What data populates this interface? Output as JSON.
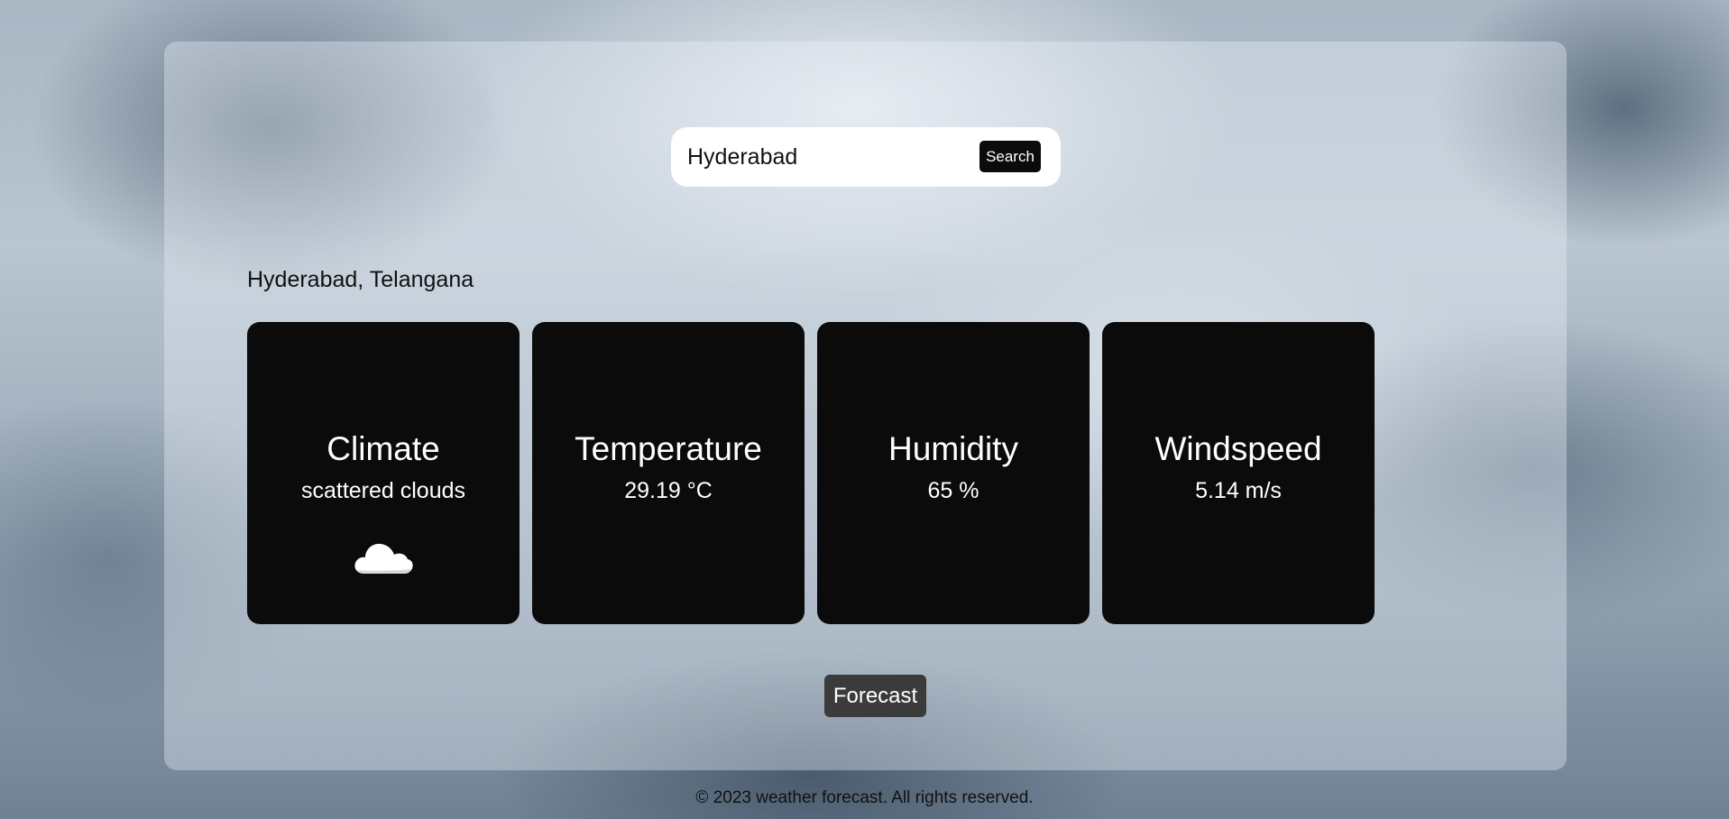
{
  "search": {
    "value": "Hyderabad",
    "button_label": "Search"
  },
  "location": "Hyderabad, Telangana",
  "cards": [
    {
      "title": "Climate",
      "value": "scattered clouds",
      "icon": "cloud-icon"
    },
    {
      "title": "Temperature",
      "value": "29.19 °C"
    },
    {
      "title": "Humidity",
      "value": "65 %"
    },
    {
      "title": "Windspeed",
      "value": "5.14 m/s"
    }
  ],
  "forecast_label": "Forecast",
  "footer": "© 2023 weather forecast. All rights reserved.",
  "colors": {
    "card_bg": "#0b0b0b",
    "button_dark": "#3b3b3b"
  }
}
